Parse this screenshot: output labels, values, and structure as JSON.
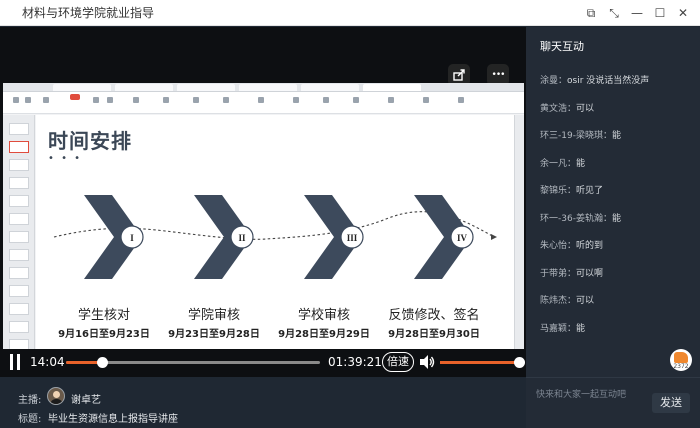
{
  "window": {
    "title": "材料与环境学院就业指导",
    "buttons": {
      "pip": "⧉",
      "fullscreen": "⤡",
      "minimize": "—",
      "maximize": "☐",
      "close": "✕"
    }
  },
  "video_overlay": {
    "share_icon": "share-icon",
    "more_label": "•••"
  },
  "slide": {
    "title": "时间安排",
    "dots": "• • •",
    "steps": [
      {
        "numeral": "I",
        "label": "学生核对",
        "dates": "9月16日至9月23日"
      },
      {
        "numeral": "II",
        "label": "学院审核",
        "dates": "9月23日至9月28日"
      },
      {
        "numeral": "III",
        "label": "学校审核",
        "dates": "9月28日至9月29日"
      },
      {
        "numeral": "IV",
        "label": "反馈修改、签名",
        "dates": "9月28日至9月30日"
      }
    ],
    "colors": {
      "chevron": "#3d4a5c",
      "title": "#3b4756"
    }
  },
  "player": {
    "current_time": "14:04",
    "total_time": "01:39:21",
    "progress": 0.141,
    "speed_label": "倍速",
    "volume": 1.0,
    "accent": "#e8622a"
  },
  "info": {
    "host_label": "主播:",
    "host_name": "谢卓艺",
    "topic_label": "标题:",
    "topic": "毕业生资源信息上报指导讲座"
  },
  "chat": {
    "header": "聊天互动",
    "messages": [
      {
        "user": "涂曼：",
        "text": "osir 没说话当然没声"
      },
      {
        "user": "黄文浩：",
        "text": "可以"
      },
      {
        "user": "环三-19-梁晓琪：",
        "text": "能"
      },
      {
        "user": "余一凡：",
        "text": "能"
      },
      {
        "user": "黎锦乐：",
        "text": "听见了"
      },
      {
        "user": "环一-36-姜轨瀚：",
        "text": "能"
      },
      {
        "user": "朱心怡：",
        "text": "听的到"
      },
      {
        "user": "于带弟：",
        "text": "可以啊"
      },
      {
        "user": "陈炜杰：",
        "text": "可以"
      },
      {
        "user": "马嘉颖：",
        "text": "能"
      }
    ],
    "likes_count": "2372",
    "input_placeholder": "快来和大家一起互动吧",
    "send_label": "发送"
  }
}
